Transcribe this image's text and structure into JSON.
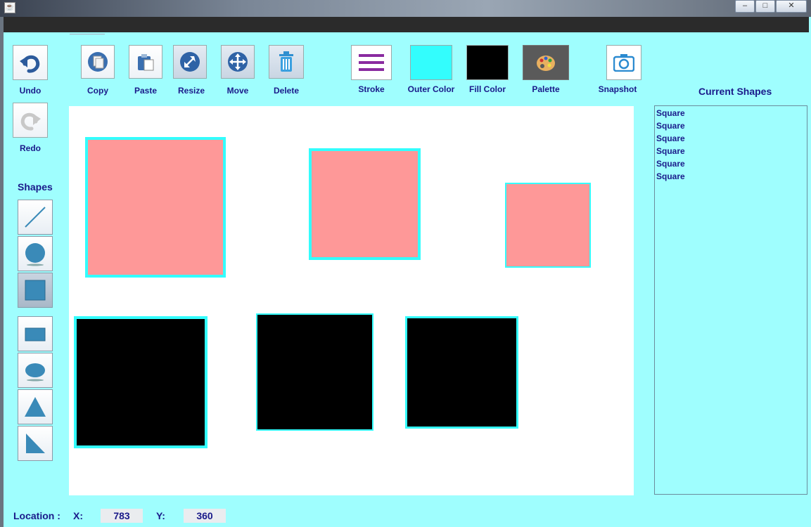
{
  "toolbar": {
    "undo": "Undo",
    "redo": "Redo",
    "copy": "Copy",
    "paste": "Paste",
    "resize": "Resize",
    "move": "Move",
    "delete": "Delete",
    "stroke": "Stroke",
    "outer_color": "Outer Color",
    "fill_color": "Fill Color",
    "palette": "Palette",
    "snapshot": "Snapshot",
    "outer_color_value": "#33fdfd",
    "fill_color_value": "#000000"
  },
  "sidebar": {
    "title": "Shapes",
    "tools": [
      "line-icon",
      "circle-icon",
      "square-icon",
      "rectangle-icon",
      "ellipse-icon",
      "triangle-icon",
      "right-triangle-icon"
    ],
    "active_tool": "square-icon"
  },
  "canvas": {
    "shapes": [
      {
        "type": "Square",
        "fill": "#fe9898",
        "outline": "#33fdfd"
      },
      {
        "type": "Square",
        "fill": "#fe9898",
        "outline": "#33fdfd"
      },
      {
        "type": "Square",
        "fill": "#fe9898",
        "outline": "#33fdfd"
      },
      {
        "type": "Square",
        "fill": "#000000",
        "outline": "#33fdfd"
      },
      {
        "type": "Square",
        "fill": "#000000",
        "outline": "#33fdfd"
      },
      {
        "type": "Square",
        "fill": "#000000",
        "outline": "#33fdfd"
      }
    ]
  },
  "current_shapes": {
    "title": "Current Shapes",
    "items": [
      "Square",
      "Square",
      "Square",
      "Square",
      "Square",
      "Square"
    ]
  },
  "status": {
    "location_label": "Location :",
    "x_label": "X:",
    "x_value": "783",
    "y_label": "Y:",
    "y_value": "360"
  }
}
